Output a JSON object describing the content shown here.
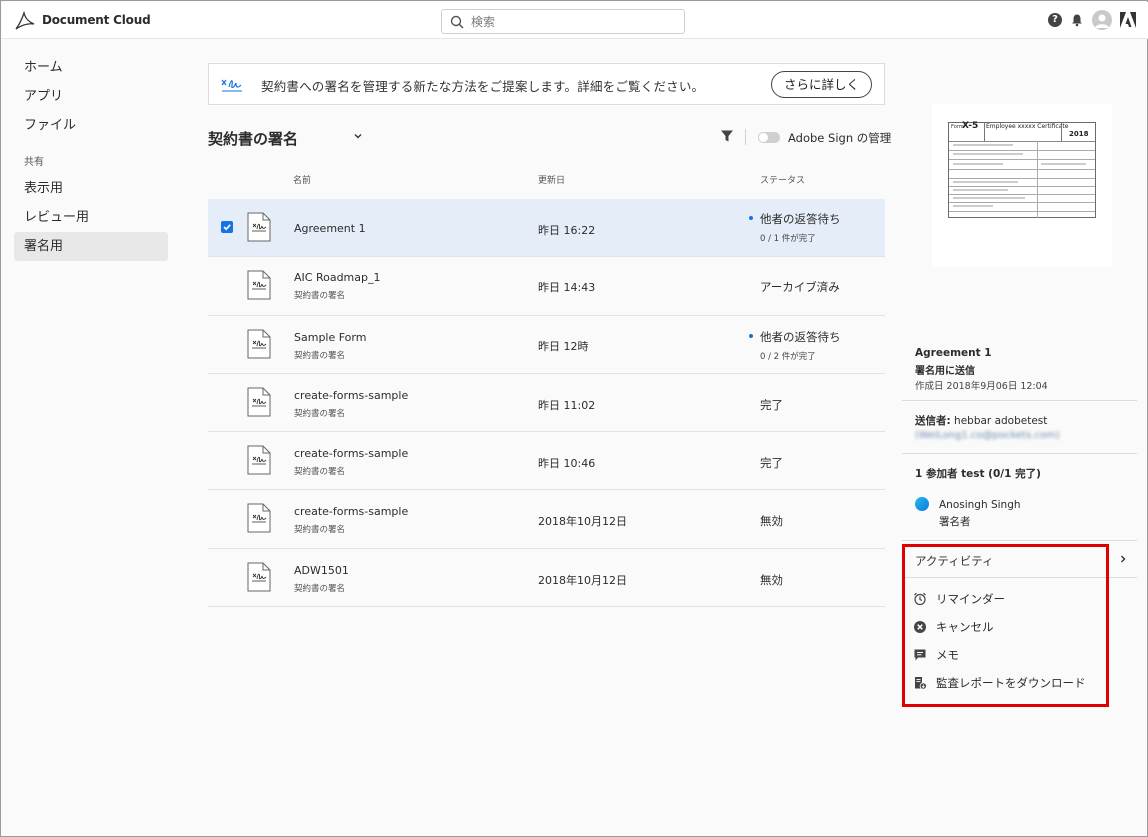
{
  "app": {
    "title": "Document Cloud"
  },
  "search": {
    "placeholder": "検索"
  },
  "header_icons": {
    "help": "help-icon",
    "bell": "bell-icon",
    "avatar": "avatar",
    "adobe": "adobe-logo-icon"
  },
  "sidebar": {
    "items": [
      {
        "label": "ホーム"
      },
      {
        "label": "アプリ"
      },
      {
        "label": "ファイル"
      }
    ],
    "section_label": "共有",
    "shared_items": [
      {
        "label": "表示用"
      },
      {
        "label": "レビュー用"
      },
      {
        "label": "署名用",
        "active": true
      }
    ]
  },
  "banner": {
    "text": "契約書への署名を管理する新たな方法をご提案します。詳細をご覧ください。",
    "button": "さらに詳しく"
  },
  "list": {
    "title": "契約書の署名",
    "toggle_label": "Adobe Sign の管理",
    "columns": {
      "name": "名前",
      "updated": "更新日",
      "status": "ステータス"
    },
    "rows": [
      {
        "name": "Agreement 1",
        "sub": "",
        "date": "昨日 16:22",
        "status": "他者の返答待ち",
        "status_sub": "0 / 1 件が完了",
        "selected": true,
        "dot": true
      },
      {
        "name": "AIC Roadmap_1",
        "sub": "契約書の署名",
        "date": "昨日 14:43",
        "status": "アーカイブ済み",
        "status_sub": "",
        "selected": false,
        "dot": false
      },
      {
        "name": "Sample Form",
        "sub": "契約書の署名",
        "date": "昨日 12時",
        "status": "他者の返答待ち",
        "status_sub": "0 / 2 件が完了",
        "selected": false,
        "dot": true
      },
      {
        "name": "create-forms-sample",
        "sub": "契約書の署名",
        "date": "昨日 11:02",
        "status": "完了",
        "status_sub": "",
        "selected": false,
        "dot": false
      },
      {
        "name": "create-forms-sample",
        "sub": "契約書の署名",
        "date": "昨日 10:46",
        "status": "完了",
        "status_sub": "",
        "selected": false,
        "dot": false
      },
      {
        "name": "create-forms-sample",
        "sub": "契約書の署名",
        "date": "2018年10月12日",
        "status": "無効",
        "status_sub": "",
        "selected": false,
        "dot": false
      },
      {
        "name": "ADW1501",
        "sub": "契約書の署名",
        "date": "2018年10月12日",
        "status": "無効",
        "status_sub": "",
        "selected": false,
        "dot": false
      }
    ]
  },
  "preview": {
    "form_label": "Form",
    "form_code": "X-5",
    "form_title": "Employee xxxxx Certificate",
    "form_year": "2018"
  },
  "details": {
    "title": "Agreement 1",
    "sent_for": "署名用に送信",
    "created": "作成日 2018年9月06日 12:04",
    "sender_label": "送信者:",
    "sender_name": "hebbar adobetest",
    "sender_email": "(WeiLong1.co@pockets.com)",
    "participants": "1 参加者 test (0/1 完了)",
    "participant_name": "Anosingh Singh",
    "participant_role": "署名者"
  },
  "activity": {
    "title": "アクティビティ",
    "actions": [
      {
        "label": "リマインダー",
        "icon": "alarm-clock-icon"
      },
      {
        "label": "キャンセル",
        "icon": "cancel-circle-icon"
      },
      {
        "label": "メモ",
        "icon": "comment-icon"
      },
      {
        "label": "監査レポートをダウンロード",
        "icon": "audit-report-download-icon"
      }
    ]
  },
  "colors": {
    "accent": "#1473e6",
    "highlight": "#e00000",
    "selected_row": "#e5edf8"
  }
}
